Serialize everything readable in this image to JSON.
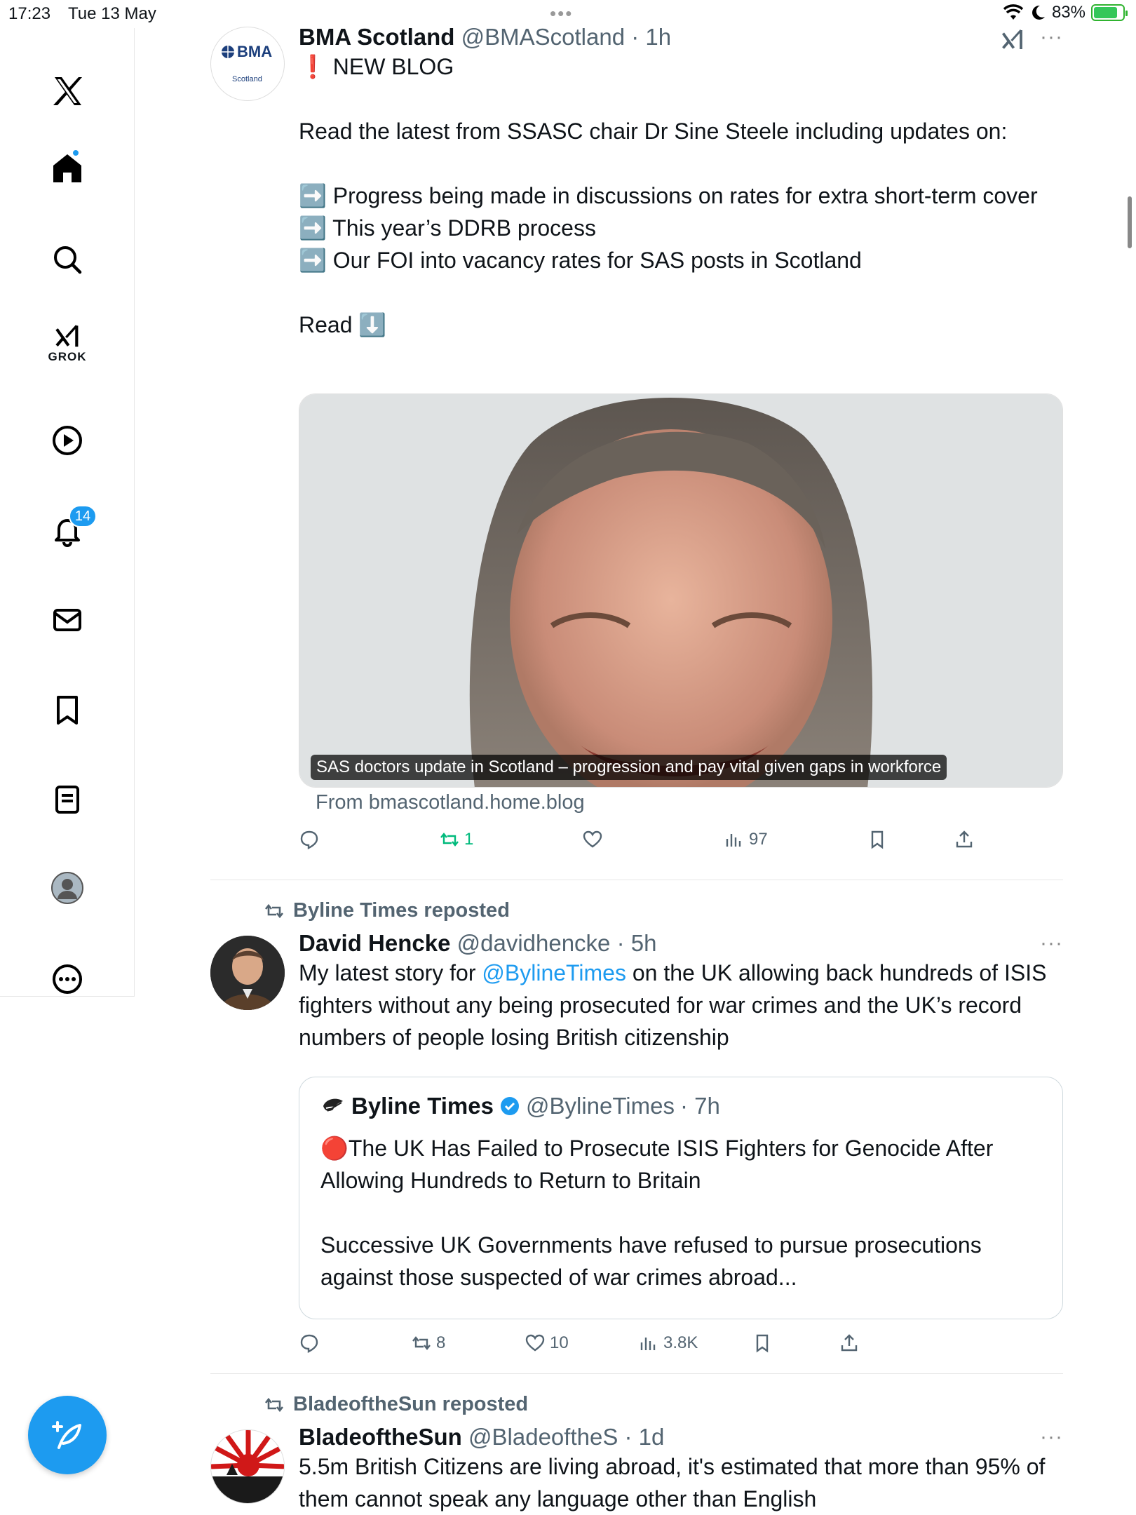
{
  "status_bar": {
    "time": "17:23",
    "date": "Tue 13 May",
    "battery": "83%",
    "battery_level": 0.83
  },
  "sidebar": {
    "grok_label": "GROK",
    "notifications_count": "14",
    "items": [
      "home",
      "explore",
      "grok",
      "videos",
      "notifications",
      "messages",
      "bookmarks",
      "lists",
      "profile",
      "more"
    ]
  },
  "tweets": [
    {
      "name": "BMA Scotland",
      "handle": "@BMAScotland",
      "time": "· 1h",
      "avatar_text": "BMA",
      "avatar_subtext": "Scotland",
      "text": "❗ NEW BLOG\n\nRead the latest from SSASC chair Dr Sine Steele including updates on:\n\n➡️ Progress being made in discussions on rates for extra short-term cover\n➡️ This year’s DDRB process\n➡️ Our FOI into vacancy rates for SAS posts in Scotland\n\nRead ⬇️",
      "card_caption": "SAS doctors update in Scotland – progression and pay vital given gaps in workforce",
      "card_source": "From bmascotland.home.blog",
      "retweets": "1",
      "views": "97"
    },
    {
      "reposted_by": "Byline Times reposted",
      "name": "David Hencke",
      "handle": "@davidhencke",
      "time": "· 5h",
      "text_before": "My latest story for ",
      "mention": "@BylineTimes",
      "text_after": " on the UK allowing back hundreds of ISIS fighters without any being prosecuted for war crimes and the UK’s record numbers of people losing British citizenship",
      "quote": {
        "name": "Byline Times",
        "handle": "@BylineTimes",
        "time": "· 7h",
        "text": "🔴The UK Has Failed to Prosecute ISIS Fighters for Genocide After Allowing Hundreds to Return to Britain\n\nSuccessive UK Governments have refused to pursue prosecutions against those suspected of war crimes abroad..."
      },
      "retweets": "8",
      "likes": "10",
      "views": "3.8K"
    },
    {
      "reposted_by": "BladeoftheSun reposted",
      "name": "BladeoftheSun",
      "handle": "@BladeoftheS",
      "time": "· 1d",
      "text": "5.5m British Citizens are living abroad, it's estimated that more than 95% of them cannot speak any language other than English"
    }
  ],
  "colors": {
    "accent": "#1d9bf0",
    "retweet_green": "#00ba7c",
    "muted": "#536471"
  }
}
